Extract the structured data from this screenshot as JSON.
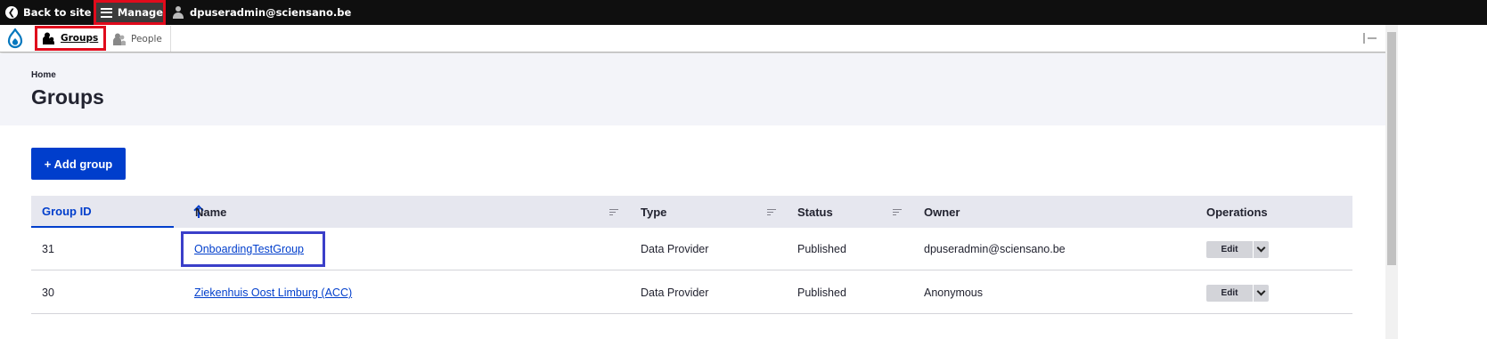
{
  "toolbar": {
    "back_label": "Back to site",
    "manage_label": "Manage",
    "user_label": "dpuseradmin@sciensano.be"
  },
  "tray": {
    "groups_label": "Groups",
    "people_label": "People"
  },
  "header": {
    "breadcrumb": "Home",
    "title": "Groups"
  },
  "actions": {
    "add_group_label": "+ Add group"
  },
  "table": {
    "columns": {
      "group_id": "Group ID",
      "name": "Name",
      "type": "Type",
      "status": "Status",
      "owner": "Owner",
      "operations": "Operations"
    },
    "rows": [
      {
        "id": "31",
        "name": "OnboardingTestGroup",
        "type": "Data Provider",
        "status": "Published",
        "owner": "dpuseradmin@sciensano.be",
        "edit": "Edit"
      },
      {
        "id": "30",
        "name": "Ziekenhuis Oost Limburg (ACC)",
        "type": "Data Provider",
        "status": "Published",
        "owner": "Anonymous",
        "edit": "Edit"
      }
    ]
  },
  "colors": {
    "accent": "#003ecc",
    "highlight_red": "#e00b1c",
    "highlight_blue": "#3a3fc9"
  }
}
